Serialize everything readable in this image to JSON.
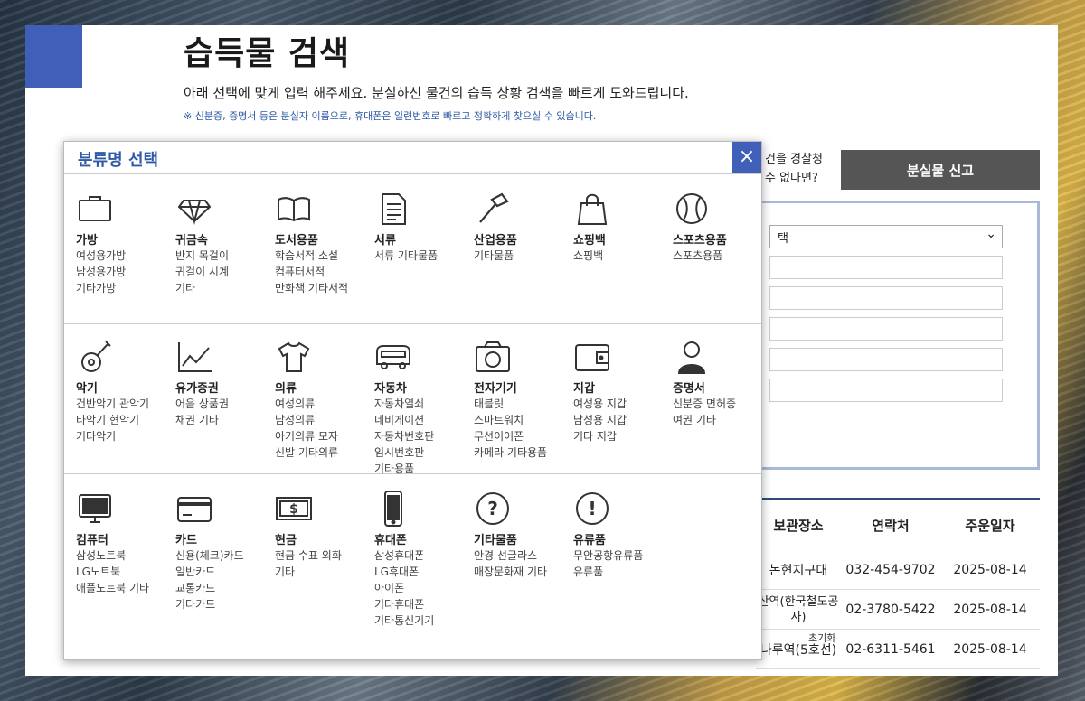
{
  "page": {
    "title": "습득물 검색",
    "subtitle": "아래 선택에 맞게 입력 해주세요. 분실하신 물건의 습득 상황 검색을 빠르게 도와드립니다.",
    "notice": "※ 신분증, 증명서 등은 분실자 이름으로, 휴대폰은 일련번호로 빠르고 정확하게 찾으실 수 있습니다."
  },
  "report": {
    "question_line1": "건을 경찰청",
    "question_line2": "수 없다면?",
    "button": "분실물 신고"
  },
  "search": {
    "select_value": "택"
  },
  "table": {
    "headers": [
      "보관장소",
      "연락처",
      "주운일자"
    ],
    "rows": [
      {
        "place": "논현지구대",
        "phone": "032-454-9702",
        "date": "2025-08-14"
      },
      {
        "place": "산역(한국철도공사)",
        "phone": "02-3780-5422",
        "date": "2025-08-14"
      },
      {
        "place": "나루역(5호선)",
        "phone": "02-6311-5461",
        "date": "2025-08-14"
      }
    ],
    "reset_label": "초기화"
  },
  "modal": {
    "title": "분류명 선택",
    "close_symbol": "×",
    "categories": [
      {
        "name": "가방",
        "icon": "briefcase-icon",
        "items": [
          "여성용가방",
          "남성용가방",
          "기타가방"
        ]
      },
      {
        "name": "귀금속",
        "icon": "diamond-icon",
        "items": [
          "반지 목걸이",
          "귀걸이 시계",
          "기타"
        ]
      },
      {
        "name": "도서용품",
        "icon": "book-icon",
        "items": [
          "학습서적 소설",
          "컴퓨터서적",
          "만화책 기타서적"
        ]
      },
      {
        "name": "서류",
        "icon": "document-icon",
        "items": [
          "서류 기타물품"
        ]
      },
      {
        "name": "산업용품",
        "icon": "hammer-icon",
        "items": [
          "기타물품"
        ]
      },
      {
        "name": "쇼핑백",
        "icon": "shopping-bag-icon",
        "items": [
          "쇼핑백"
        ]
      },
      {
        "name": "스포츠용품",
        "icon": "baseball-icon",
        "items": [
          "스포츠용품"
        ]
      },
      {
        "name": "악기",
        "icon": "guitar-icon",
        "items": [
          "건반악기 관악기",
          "타악기 현악기",
          "기타악기"
        ]
      },
      {
        "name": "유가증권",
        "icon": "chart-icon",
        "items": [
          "어음 상품권",
          "채권 기타"
        ]
      },
      {
        "name": "의류",
        "icon": "tshirt-icon",
        "items": [
          "여성의류",
          "남성의류",
          "아기의류 모자",
          "신발 기타의류"
        ]
      },
      {
        "name": "자동차",
        "icon": "car-icon",
        "items": [
          "자동차열쇠",
          "네비게이션",
          "자동차번호판",
          "임시번호판",
          "기타용품"
        ]
      },
      {
        "name": "전자기기",
        "icon": "camera-icon",
        "items": [
          "태블릿",
          "스마트워치",
          "무선이어폰",
          "카메라 기타용품"
        ]
      },
      {
        "name": "지갑",
        "icon": "wallet-icon",
        "items": [
          "여성용 지갑",
          "남성용 지갑",
          "기타 지갑"
        ]
      },
      {
        "name": "증명서",
        "icon": "person-icon",
        "items": [
          "신분증 면허증",
          "여권 기타"
        ]
      },
      {
        "name": "컴퓨터",
        "icon": "monitor-icon",
        "items": [
          "삼성노트북",
          "LG노트북",
          "애플노트북 기타"
        ]
      },
      {
        "name": "카드",
        "icon": "card-icon",
        "items": [
          "신용(체크)카드",
          "일반카드",
          "교통카드",
          "기타카드"
        ]
      },
      {
        "name": "현금",
        "icon": "cash-icon",
        "items": [
          "현금 수표 외화",
          "기타"
        ]
      },
      {
        "name": "휴대폰",
        "icon": "phone-icon",
        "items": [
          "삼성휴대폰",
          "LG휴대폰",
          "아이폰",
          "기타휴대폰",
          "기타통신기기"
        ]
      },
      {
        "name": "기타물품",
        "icon": "question-icon",
        "items": [
          "안경 선글라스",
          "매장문화재 기타"
        ]
      },
      {
        "name": "유류품",
        "icon": "exclamation-icon",
        "items": [
          "무안공항유류품",
          "유류품"
        ]
      }
    ]
  }
}
